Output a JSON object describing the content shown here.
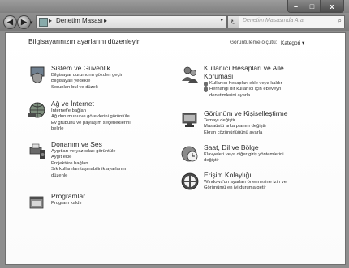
{
  "window": {
    "minimize_label": "–",
    "maximize_label": "□",
    "close_label": "x"
  },
  "nav": {
    "back_label": "◀",
    "forward_label": "▶",
    "address_separator": "▸",
    "address_text": "Denetim Masası",
    "address_trail": "▸",
    "address_dropdown": "▾",
    "refresh_glyph": "↻",
    "search_placeholder": "Denetim Masasında Ara",
    "search_glyph": "⌕"
  },
  "main": {
    "heading": "Bilgisayarınızın ayarlarını düzenleyin",
    "view_by_label": "Görüntüleme ölçütü:",
    "view_by_value": "Kategori ▾"
  },
  "left_categories": [
    {
      "title": "Sistem ve Güvenlik",
      "icon": "shield-monitor-icon",
      "links": [
        "Bilgisayar durumunu gözden geçir",
        "Bilgisayarı yedekle",
        "Sorunları bul ve düzelt"
      ]
    },
    {
      "title": "Ağ ve İnternet",
      "icon": "network-globe-icon",
      "links": [
        "İnternet'e bağlan",
        "Ağ durumunu ve görevlerini görüntüle",
        "Ev grubunu ve paylaşım seçeneklerini",
        "belirle"
      ]
    },
    {
      "title": "Donanım ve Ses",
      "icon": "printer-speaker-icon",
      "links": [
        "Aygıtları ve yazıcıları görüntüle",
        "Aygıt ekle",
        "Projektöre bağlan",
        "Sık kullanılan taşınabilirlik ayarlarını",
        "düzenle"
      ]
    },
    {
      "title": "Programlar",
      "icon": "programs-icon",
      "links": [
        "Program kaldır"
      ]
    }
  ],
  "right_categories": [
    {
      "title_line1": "Kullanıcı Hesapları ve Aile",
      "title_line2": "Koruması",
      "icon": "users-icon",
      "links": [
        "Kullanıcı hesapları ekle veya kaldır",
        "Herhangi bir kullanıcı için ebeveyn",
        "denetimlerini ayarla"
      ]
    },
    {
      "title": "Görünüm ve Kişiselleştirme",
      "icon": "display-icon",
      "links": [
        "Temayı değiştir",
        "Masaüstü arka planını değiştir",
        "Ekran çözünürlüğünü ayarla"
      ]
    },
    {
      "title": "Saat, Dil ve Bölge",
      "icon": "clock-globe-icon",
      "links": [
        "Klavyeleri veya diğer giriş yöntemlerini",
        "değiştir"
      ]
    },
    {
      "title": "Erişim Kolaylığı",
      "icon": "ease-of-access-icon",
      "links": [
        "Windows'un ayarları önermesine izin ver",
        "Görünümü en iyi duruma getir"
      ]
    }
  ]
}
